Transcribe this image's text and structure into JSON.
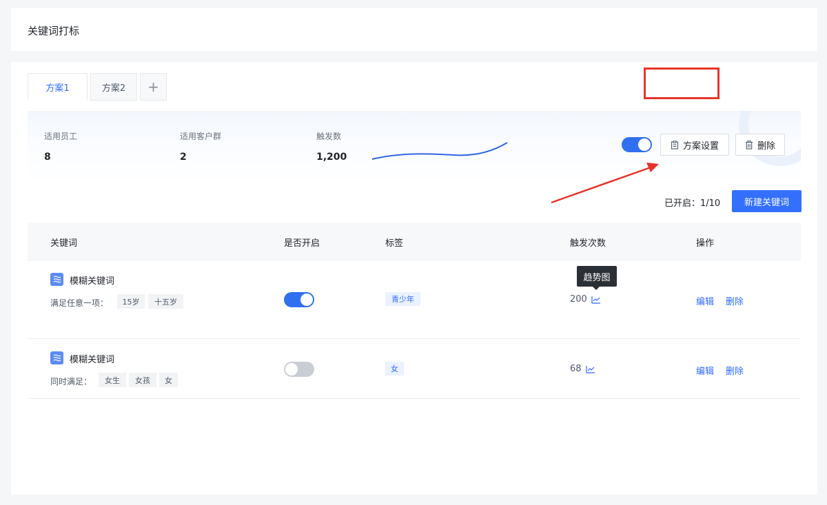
{
  "page": {
    "title": "关键词打标"
  },
  "tabs": [
    {
      "label": "方案1",
      "active": true
    },
    {
      "label": "方案2",
      "active": false
    }
  ],
  "tab_add_label": "+",
  "summary": {
    "stats": [
      {
        "label": "适用员工",
        "value": "8"
      },
      {
        "label": "适用客户群",
        "value": "2"
      },
      {
        "label": "触发数",
        "value": "1,200"
      }
    ],
    "plan_enabled": true,
    "plan_settings_label": "方案设置",
    "delete_label": "删除"
  },
  "enabled_count": "已开启：1/10",
  "new_keyword_label": "新建关键词",
  "table": {
    "columns": [
      "关键词",
      "是否开启",
      "标签",
      "触发次数",
      "操作"
    ],
    "rows": [
      {
        "name": "模糊关键词",
        "condition": "满足任意一项：",
        "chips": [
          "15岁",
          "十五岁"
        ],
        "enabled": true,
        "tag": "青少年",
        "count": "200",
        "edit": "编辑",
        "delete": "删除"
      },
      {
        "name": "模糊关键词",
        "condition": "同时满足：",
        "chips": [
          "女生",
          "女孩",
          "女"
        ],
        "enabled": false,
        "tag": "女",
        "count": "68",
        "edit": "编辑",
        "delete": "删除"
      }
    ]
  },
  "tooltip": "趋势图",
  "colors": {
    "primary": "#3370ff",
    "switch_on": "#3070f0",
    "switch_off": "#c9cdd4",
    "annotation_red": "#e8332a"
  }
}
